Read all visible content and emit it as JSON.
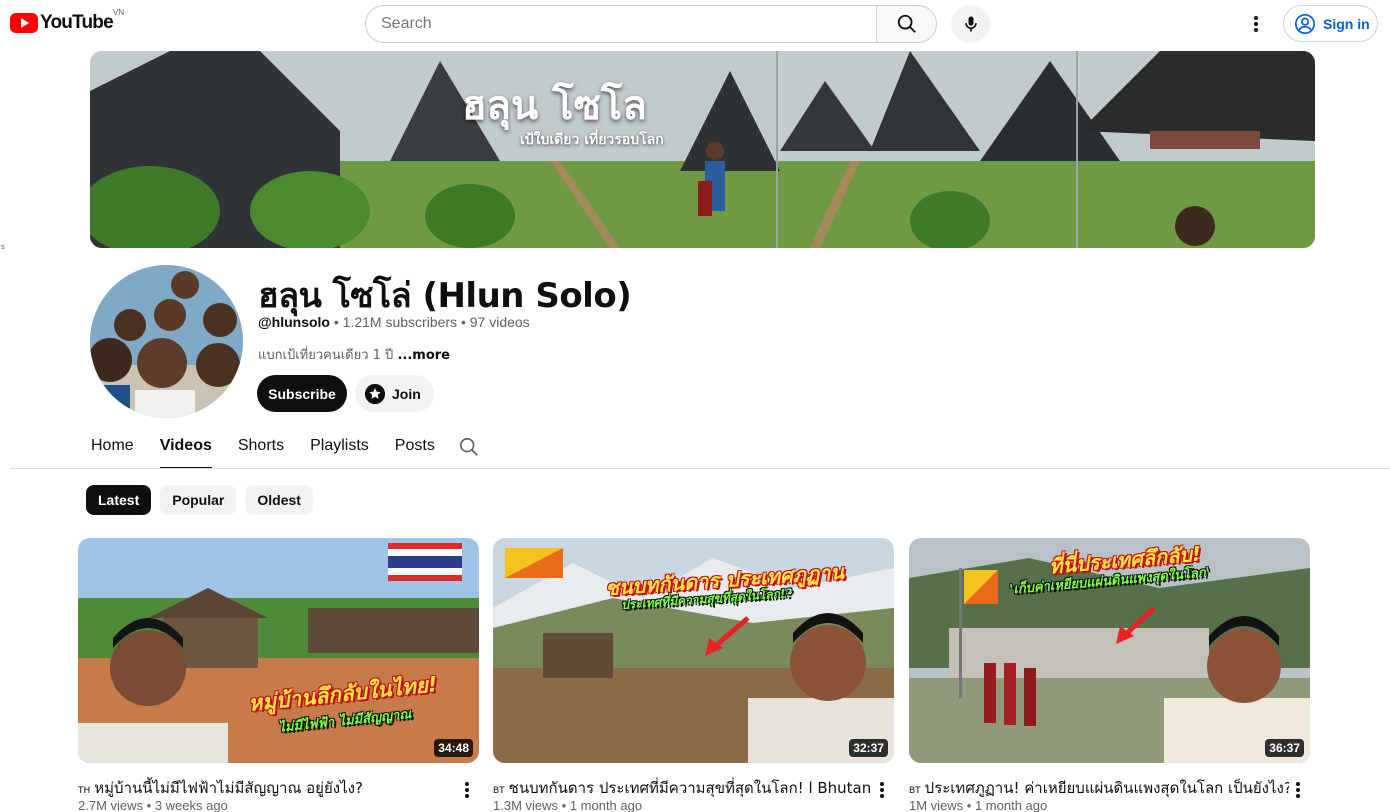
{
  "header": {
    "logo_text": "YouTube",
    "country_code": "VN",
    "search_placeholder": "Search",
    "signin_label": "Sign in"
  },
  "edge_mark": "s",
  "banner": {
    "title": "ฮลุน โซโล",
    "subtitle": "เป้ใบเดียว เที่ยวรอบโลก"
  },
  "channel": {
    "name": "ฮลุน โซโล่ (Hlun Solo)",
    "handle": "@hlunsolo",
    "subscribers": "1.21M subscribers",
    "videos": "97 videos",
    "separator": "•",
    "description": "แบกเป้เที่ยวคนเดียว 1 ปี",
    "more_label": "...more",
    "subscribe_label": "Subscribe",
    "join_label": "Join"
  },
  "tabs": [
    {
      "label": "Home"
    },
    {
      "label": "Videos"
    },
    {
      "label": "Shorts"
    },
    {
      "label": "Playlists"
    },
    {
      "label": "Posts"
    }
  ],
  "active_tab": "Videos",
  "chips": [
    {
      "label": "Latest"
    },
    {
      "label": "Popular"
    },
    {
      "label": "Oldest"
    }
  ],
  "videos": [
    {
      "lang": "TH",
      "title": "หมู่บ้านนี้ไม่มีไฟฟ้าไม่มีสัญญาณ อยู่ยังไง?",
      "views": "2.7M views",
      "age": "3 weeks ago",
      "duration": "34:48",
      "overlay_main": "หมู่บ้านลึกลับในไทย!",
      "overlay_sub": "ไม่มีไฟฟ้า ไม่มีสัญญาณ"
    },
    {
      "lang": "BT",
      "title": "ชนบทกันดาร ประเทศที่มีความสุขที่สุดในโลก! l Bhutan",
      "views": "1.3M views",
      "age": "1 month ago",
      "duration": "32:37",
      "overlay_main": "ชนบทกันดาร ประเทศภูฏาน",
      "overlay_sub": "ประเทศที่มีความสุขที่สุดในโลก!?"
    },
    {
      "lang": "BT",
      "title": "ประเทศภูฏาน! ค่าเหยียบแผ่นดินแพงสุดในโลก เป็นยังไง?",
      "views": "1M views",
      "age": "1 month ago",
      "duration": "36:37",
      "overlay_main": "ที่นี่ประเทศลึกลับ!",
      "overlay_sub": "'เก็บค่าเหยียบแผ่นดินแพงสุดในโลก'"
    }
  ],
  "colors": {
    "brand_red": "#ff0000",
    "link_blue": "#065fd4",
    "text_primary": "#0f0f0f",
    "text_secondary": "#606060"
  }
}
